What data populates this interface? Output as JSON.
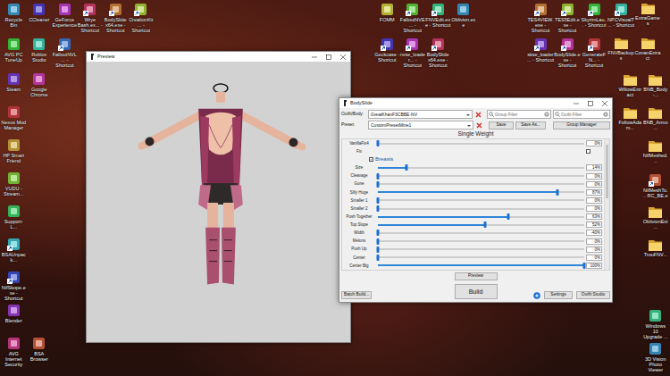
{
  "desktop": {
    "top_left_rows": [
      [
        {
          "label": "Recycle Bin",
          "kind": "app"
        },
        {
          "label": "CCleaner",
          "kind": "app"
        },
        {
          "label": "GeForce Experience",
          "kind": "app"
        },
        {
          "label": "Wrye Bash.ex... - Shortcut",
          "kind": "shortcut"
        },
        {
          "label": "BodySlide x64.exe - Shortcut",
          "kind": "shortcut"
        },
        {
          "label": "CreationKit... - Shortcut",
          "kind": "shortcut"
        }
      ],
      [
        {
          "label": "AVG PC TuneUp",
          "kind": "app"
        },
        {
          "label": "Roblox Studio",
          "kind": "app"
        },
        {
          "label": "FalloutNVL... - Shortcut",
          "kind": "shortcut"
        }
      ]
    ],
    "left_column_rows": [
      [
        {
          "label": "Steam",
          "kind": "app"
        },
        {
          "label": "Google Chrome",
          "kind": "app"
        }
      ],
      [
        {
          "label": "Nexus Mod Manager",
          "kind": "app"
        }
      ],
      [
        {
          "label": "HP Smart Friend",
          "kind": "app"
        }
      ],
      [
        {
          "label": "VUDU - Stream...",
          "kind": "app"
        }
      ],
      [
        {
          "label": "Support-L...",
          "kind": "app"
        }
      ],
      [
        {
          "label": "BSAUnpack...",
          "kind": "shortcut"
        }
      ],
      [
        {
          "label": "NifSkope.exe - Shortcut",
          "kind": "shortcut"
        }
      ],
      [
        {
          "label": "Blender",
          "kind": "app"
        }
      ],
      [
        {
          "label": "AVG Internet Security",
          "kind": "app"
        },
        {
          "label": "BSA Browser",
          "kind": "app"
        }
      ]
    ],
    "top_middle_rows": [
      [
        {
          "label": "FOMM",
          "kind": "app"
        },
        {
          "label": "FalloutNVE... - Shortcut",
          "kind": "shortcut"
        },
        {
          "label": "FNVEdit.exe - Shortcut",
          "kind": "shortcut"
        },
        {
          "label": "Oblivion.exe",
          "kind": "app"
        }
      ],
      [
        {
          "label": "Geckcase - Shortcut",
          "kind": "shortcut"
        },
        {
          "label": "nvse_loader... - Shortcut",
          "kind": "shortcut"
        },
        {
          "label": "BodySlide x64.exe - Shortcut",
          "kind": "shortcut"
        }
      ]
    ],
    "top_right_rows": [
      [
        {
          "label": "TES4VIEW.exe - Shortcut",
          "kind": "shortcut"
        },
        {
          "label": "TES5Edit.exe - Shortcut",
          "kind": "shortcut"
        },
        {
          "label": "SkyrimLau... - Shortcut",
          "kind": "shortcut"
        },
        {
          "label": "NPCVisualT... - Shortcut",
          "kind": "shortcut"
        },
        {
          "label": "ExtraGames",
          "kind": "folder"
        }
      ],
      [
        {
          "label": "skse_loader... - Shortcut",
          "kind": "shortcut"
        },
        {
          "label": "BodySlide.exe - Shortcut",
          "kind": "shortcut"
        },
        {
          "label": "GenerateFN... - Shortcut",
          "kind": "shortcut"
        },
        {
          "label": "FNVBackups",
          "kind": "folder"
        },
        {
          "label": "ConanExtract",
          "kind": "folder"
        }
      ]
    ],
    "right_column_rows": [
      [
        {
          "label": "WillowExtract",
          "kind": "folder"
        },
        {
          "label": "BNB_Body-...",
          "kind": "folder"
        }
      ],
      [
        {
          "label": "FollowAdam...",
          "kind": "folder"
        },
        {
          "label": "BNB_Armo...",
          "kind": "folder"
        }
      ],
      [
        {
          "label": "NifMeshed...",
          "kind": "folder"
        }
      ],
      [
        {
          "label": "NifMeshTo... RC_BE.e",
          "kind": "shortcut"
        }
      ],
      [
        {
          "label": "OblivionExt...",
          "kind": "folder"
        }
      ],
      [
        {
          "label": "TrouFNV...",
          "kind": "folder"
        }
      ]
    ],
    "bottom_right_rows": [
      [
        {
          "label": "Windows 10 Upgrade ...",
          "kind": "app"
        }
      ],
      [
        {
          "label": "3D Vision Photo Viewer",
          "kind": "app"
        }
      ]
    ]
  },
  "preview_window": {
    "title": "Preview"
  },
  "bodyslide_window": {
    "title": "BodySlide",
    "outfit_label": "Outfit/Body:",
    "outfit_value": "GreatKhanF3CBBE-NV",
    "group_filter": {
      "placeholder": "Group Filter"
    },
    "outfit_filter": {
      "placeholder": "Outfit Filter"
    },
    "preset_label": "Preset:",
    "preset_value": "CustomPresetMine1",
    "preset_buttons": [
      "Save",
      "Save As...",
      "Group Manager"
    ],
    "mode": "Single Weight",
    "sliders": [
      {
        "kind": "slider",
        "name": "VanillaFix4",
        "level": 0,
        "reading": "0%"
      },
      {
        "kind": "checkbox",
        "name": "Fix",
        "checked": false
      },
      {
        "kind": "group",
        "name": "Breasts",
        "checked": true
      },
      {
        "kind": "slider",
        "name": "Size",
        "level": 0.14,
        "reading": "14%"
      },
      {
        "kind": "slider",
        "name": "Cleavage",
        "level": 0,
        "reading": "0%"
      },
      {
        "kind": "slider",
        "name": "Gone",
        "level": 0,
        "reading": "0%"
      },
      {
        "kind": "slider",
        "name": "Silly Huge",
        "level": 0.87,
        "reading": "87%"
      },
      {
        "kind": "slider",
        "name": "Smaller 1",
        "level": 0,
        "reading": "0%"
      },
      {
        "kind": "slider",
        "name": "Smaller 2",
        "level": 0,
        "reading": "0%"
      },
      {
        "kind": "slider",
        "name": "Push Together",
        "level": 0.63,
        "reading": "63%"
      },
      {
        "kind": "slider",
        "name": "Top Slope",
        "level": 0.52,
        "reading": "52%"
      },
      {
        "kind": "slider",
        "name": "Width",
        "level": 0,
        "reading": "-40%"
      },
      {
        "kind": "slider",
        "name": "Melons",
        "level": 0,
        "reading": "0%"
      },
      {
        "kind": "slider",
        "name": "Push Up",
        "level": 0,
        "reading": "0%"
      },
      {
        "kind": "slider",
        "name": "Center",
        "level": 0,
        "reading": "0%"
      },
      {
        "kind": "slider",
        "name": "Center Big",
        "level": 1,
        "reading": "100%"
      }
    ],
    "preview_button": "Preview",
    "batch_button": "Batch Build...",
    "build_button": "Build",
    "settings_button": "Settings",
    "studio_button": "Outfit Studio"
  }
}
